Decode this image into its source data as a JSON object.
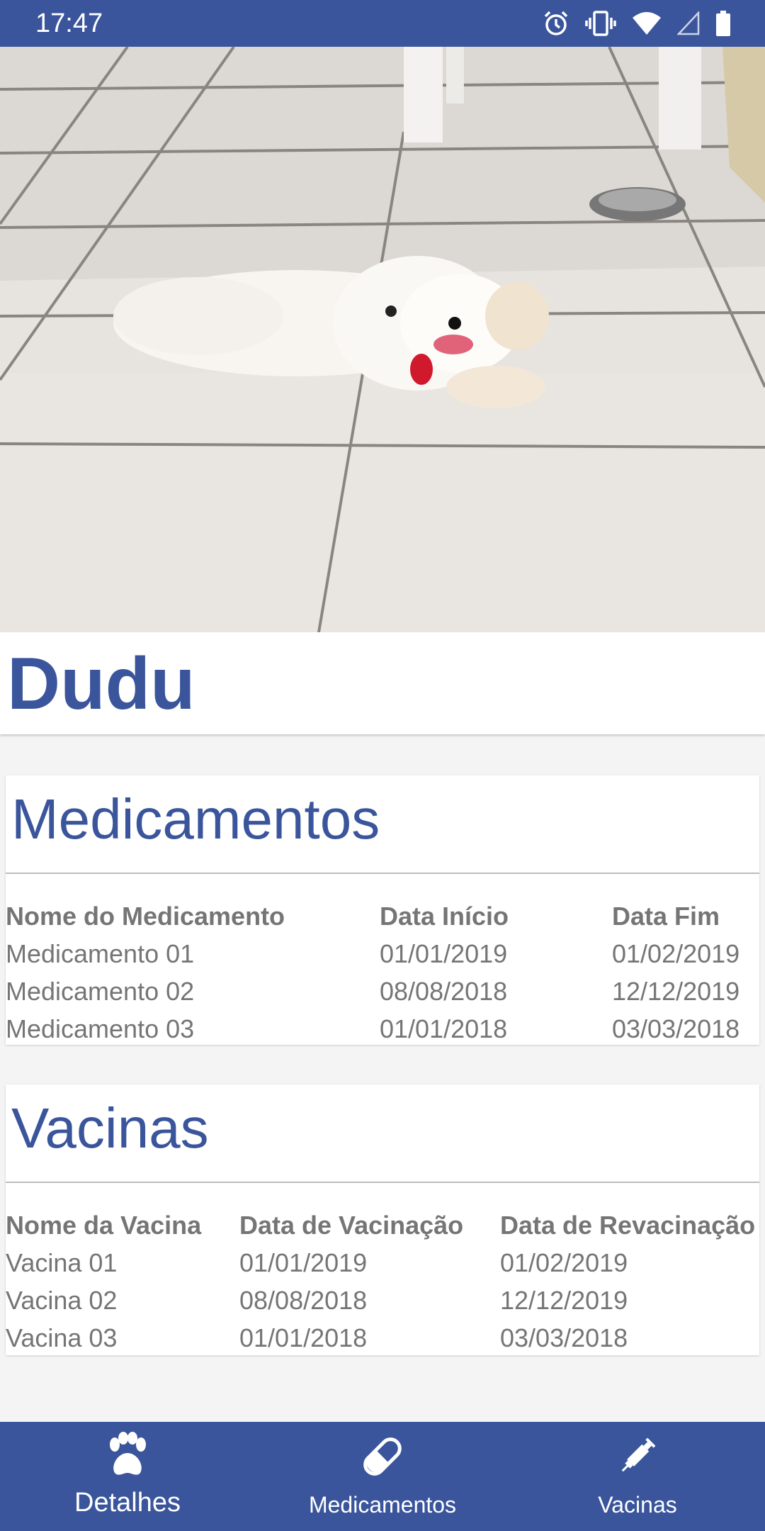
{
  "status_bar": {
    "time": "17:47",
    "icons": [
      "alarm-icon",
      "vibrate-icon",
      "wifi-icon",
      "signal-icon",
      "battery-icon"
    ]
  },
  "hero": {
    "subject": "pet-photo"
  },
  "pet": {
    "name": "Dudu"
  },
  "medicamentos": {
    "title": "Medicamentos",
    "headers": [
      "Nome do Medicamento",
      "Data Início",
      "Data Fim"
    ],
    "rows": [
      [
        "Medicamento 01",
        "01/01/2019",
        "01/02/2019"
      ],
      [
        "Medicamento 02",
        "08/08/2018",
        "12/12/2019"
      ],
      [
        "Medicamento 03",
        "01/01/2018",
        "03/03/2018"
      ]
    ]
  },
  "vacinas": {
    "title": "Vacinas",
    "headers": [
      "Nome da Vacina",
      "Data de Vacinação",
      "Data de Revacinação"
    ],
    "rows": [
      [
        "Vacina 01",
        "01/01/2019",
        "01/02/2019"
      ],
      [
        "Vacina 02",
        "08/08/2018",
        "12/12/2019"
      ],
      [
        "Vacina 03",
        "01/01/2018",
        "03/03/2018"
      ]
    ]
  },
  "bottom_nav": {
    "items": [
      {
        "label": "Detalhes",
        "icon": "paw-icon"
      },
      {
        "label": "Medicamentos",
        "icon": "pill-icon"
      },
      {
        "label": "Vacinas",
        "icon": "syringe-icon"
      }
    ]
  },
  "colors": {
    "primary": "#3a559b",
    "text_muted": "#757575",
    "background": "#f4f4f4"
  }
}
